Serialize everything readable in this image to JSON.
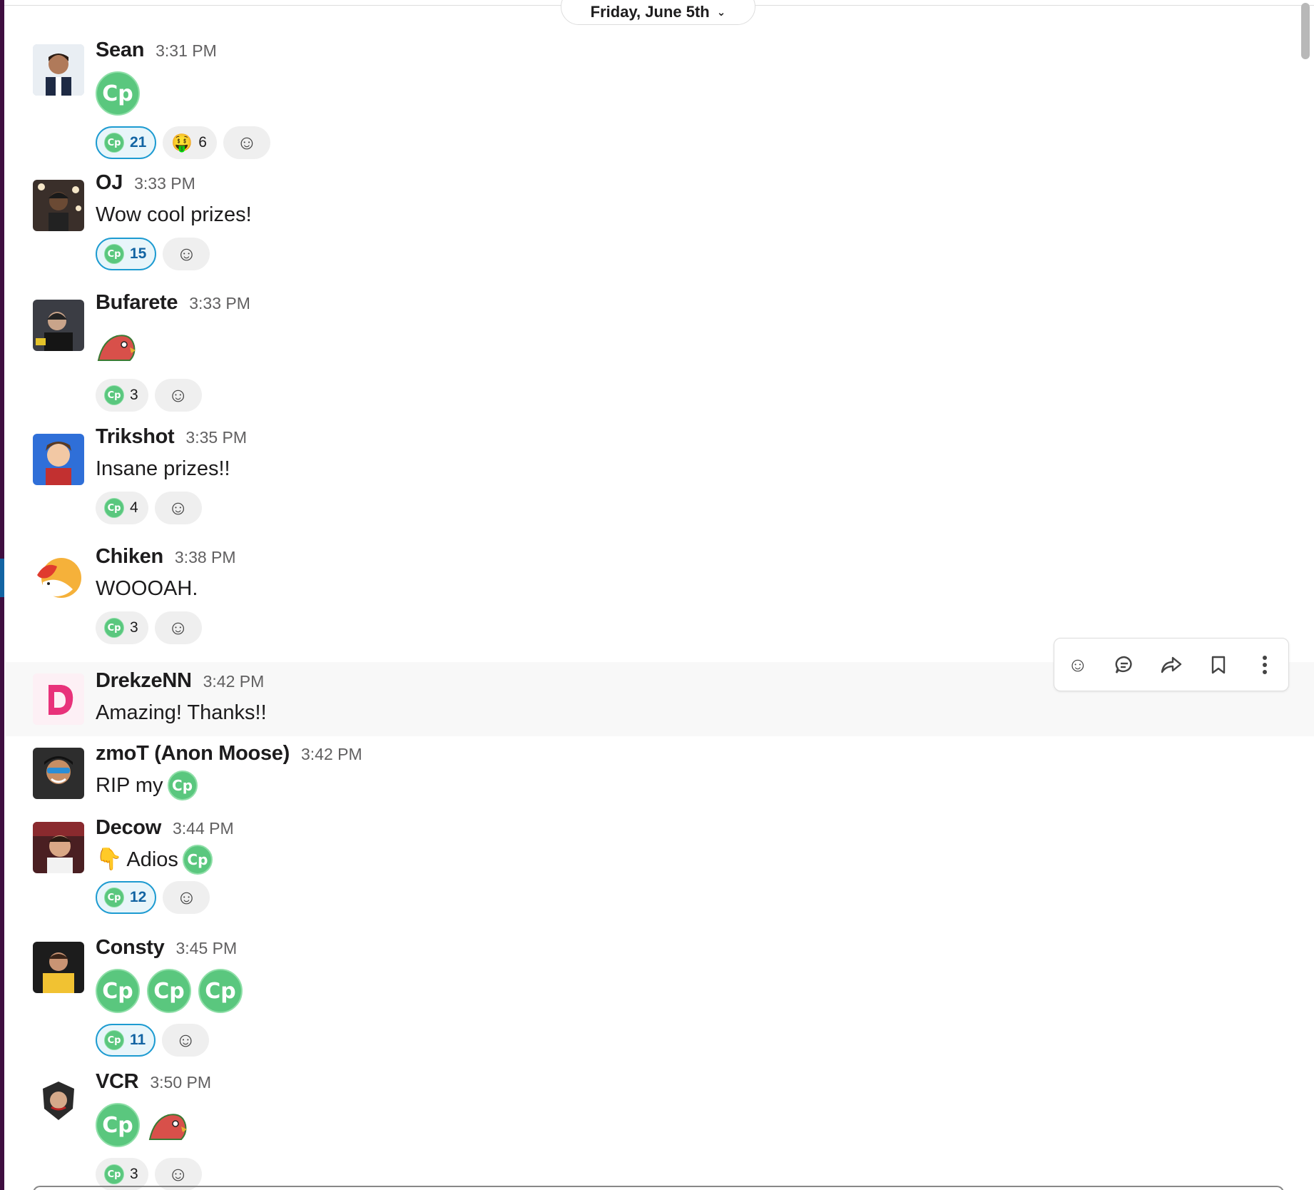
{
  "date_divider": {
    "label": "Friday, June 5th",
    "chevron_icon": "chevron-down-icon"
  },
  "messages": [
    {
      "author": "Sean",
      "time": "3:31 PM",
      "text": "",
      "big_emojis": [
        "Cp"
      ],
      "reactions": [
        {
          "emoji": "Cp",
          "count": "21",
          "mine": true
        },
        {
          "emoji": "money-mouth-face",
          "count": "6",
          "mine": false
        }
      ]
    },
    {
      "author": "OJ",
      "time": "3:33 PM",
      "text": "Wow cool prizes!",
      "reactions": [
        {
          "emoji": "Cp",
          "count": "15",
          "mine": true
        }
      ]
    },
    {
      "author": "Bufarete",
      "time": "3:33 PM",
      "text": "",
      "big_emojis": [
        "parrot"
      ],
      "reactions": [
        {
          "emoji": "Cp",
          "count": "3",
          "mine": false
        }
      ]
    },
    {
      "author": "Trikshot",
      "time": "3:35 PM",
      "text": "Insane prizes!!",
      "reactions": [
        {
          "emoji": "Cp",
          "count": "4",
          "mine": false
        }
      ]
    },
    {
      "author": "Chiken",
      "time": "3:38 PM",
      "text": "WOOOAH.",
      "reactions": [
        {
          "emoji": "Cp",
          "count": "3",
          "mine": false
        }
      ]
    },
    {
      "author": "DrekzeNN",
      "time": "3:42 PM",
      "text": "Amazing! Thanks!!"
    },
    {
      "author": "zmoT (Anon Moose)",
      "time": "3:42 PM",
      "text": "RIP my"
    },
    {
      "author": "Decow",
      "time": "3:44 PM",
      "text": "Adios",
      "reactions": [
        {
          "emoji": "Cp",
          "count": "12",
          "mine": true
        }
      ]
    },
    {
      "author": "Consty",
      "time": "3:45 PM",
      "text": "",
      "big_emojis": [
        "Cp",
        "Cp",
        "Cp"
      ],
      "reactions": [
        {
          "emoji": "Cp",
          "count": "11",
          "mine": true
        }
      ]
    },
    {
      "author": "VCR",
      "time": "3:50 PM",
      "text": "",
      "big_emojis": [
        "Cp",
        "parrot"
      ],
      "reactions": [
        {
          "emoji": "Cp",
          "count": "3",
          "mine": false
        }
      ]
    }
  ],
  "emoji_label": "Cp",
  "hover_actions": [
    "add-reaction-icon",
    "reply-in-thread-icon",
    "share-message-icon",
    "save-message-icon",
    "more-actions-icon"
  ],
  "colors": {
    "accent_blue": "#1264a3",
    "cp_green": "#5ac77e",
    "sidebar": "#3f0e40",
    "hover_bg": "#f8f8f8"
  }
}
